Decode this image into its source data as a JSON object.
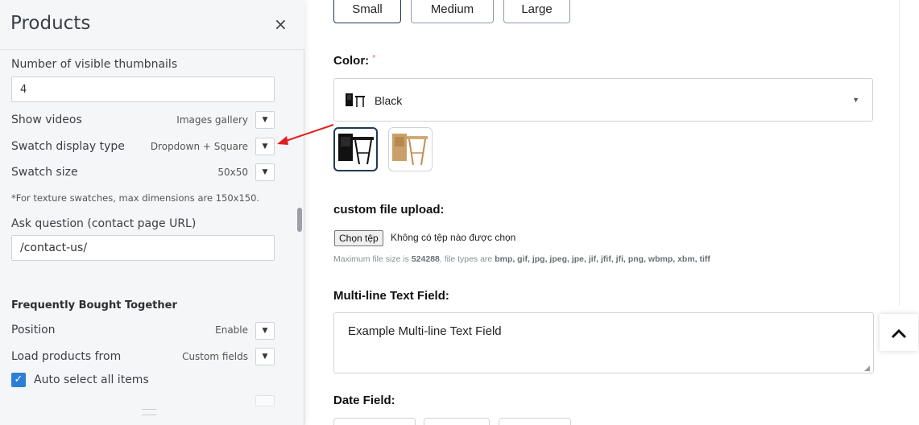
{
  "panel": {
    "title": "Products",
    "close_glyph": "×",
    "thumbnails_label": "Number of visible thumbnails",
    "thumbnails_value": "4",
    "show_videos_label": "Show videos",
    "show_videos_value": "Images gallery",
    "swatch_type_label": "Swatch display type",
    "swatch_type_value": "Dropdown + Square",
    "swatch_size_label": "Swatch size",
    "swatch_size_value": "50x50",
    "swatch_note": "*For texture swatches, max dimensions are 150x150.",
    "ask_question_label": "Ask question (contact page URL)",
    "ask_question_value": "/contact-us/",
    "fbt_heading": "Frequently Bought Together",
    "position_label": "Position",
    "position_value": "Enable",
    "load_from_label": "Load products from",
    "load_from_value": "Custom fields",
    "auto_select_label": "Auto select all items",
    "dropdown_glyph": "▼",
    "check_glyph": "✓"
  },
  "form": {
    "sizes": [
      "Small",
      "Medium",
      "Large"
    ],
    "selected_size": "Small",
    "color_label": "Color:",
    "required_mark": "*",
    "color_value": "Black",
    "color_caret": "▼",
    "file_label": "custom file upload:",
    "file_button": "Chọn tệp",
    "file_status": "Không có tệp nào được chọn",
    "file_note_prefix": "Maximum file size is ",
    "file_max_size": "524288",
    "file_note_middle": ", file types are ",
    "file_types": "bmp, gif, jpg, jpeg, jpe, jif, jfif, jfi, png, wbmp, xbm, tiff",
    "multiline_label": "Multi-line Text Field:",
    "multiline_value": "Example  Multi-line Text Field",
    "date_label": "Date Field:",
    "scroll_top_glyph": "^"
  },
  "icons": {
    "close": "close-icon",
    "dropdown": "chevron-down-icon",
    "check": "check-icon",
    "scroll_top": "chevron-up-icon",
    "annotation": "arrow-icon"
  },
  "colors": {
    "accent": "#2d7fd6",
    "selected_border": "#1f3a55",
    "required": "#e0566a",
    "annotation_arrow": "#e02020"
  }
}
